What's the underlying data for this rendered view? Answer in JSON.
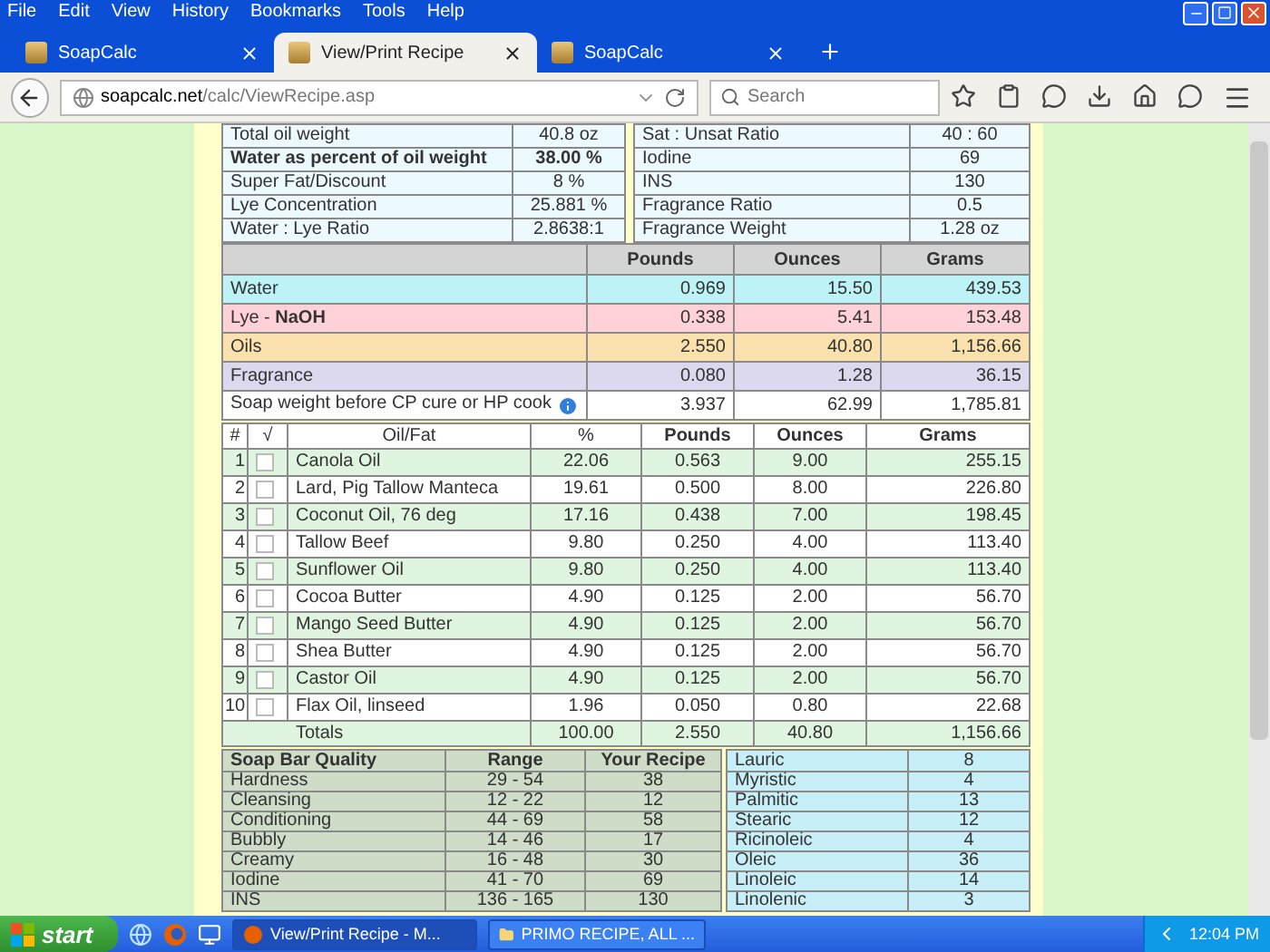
{
  "browser": {
    "menu": [
      "File",
      "Edit",
      "View",
      "History",
      "Bookmarks",
      "Tools",
      "Help"
    ],
    "tabs": [
      {
        "title": "SoapCalc",
        "selected": false
      },
      {
        "title": "View/Print Recipe",
        "selected": true
      },
      {
        "title": "SoapCalc",
        "selected": false
      }
    ],
    "address": {
      "host": "soapcalc.net",
      "path": "/calc/ViewRecipe.asp"
    },
    "search": {
      "placeholder": "Search"
    }
  },
  "recipe": {
    "left": [
      {
        "label": "Total oil weight",
        "value": "40.8 oz",
        "bold": false
      },
      {
        "label": "Water as percent of oil weight",
        "value": "38.00 %",
        "bold": true
      },
      {
        "label": "Super Fat/Discount",
        "value": "8 %",
        "bold": false
      },
      {
        "label": "Lye Concentration",
        "value": "25.881 %",
        "bold": false
      },
      {
        "label": "Water : Lye Ratio",
        "value": "2.8638:1",
        "bold": false
      }
    ],
    "right": [
      {
        "label": "Sat : Unsat Ratio",
        "value": "40 : 60"
      },
      {
        "label": "Iodine",
        "value": "69"
      },
      {
        "label": "INS",
        "value": "130"
      },
      {
        "label": "Fragrance Ratio",
        "value": "0.5"
      },
      {
        "label": "Fragrance Weight",
        "value": "1.28 oz"
      }
    ]
  },
  "summary": {
    "columns": [
      "Pounds",
      "Ounces",
      "Grams"
    ],
    "rows": [
      {
        "kind": "water",
        "label": "Water",
        "pounds": "0.969",
        "ounces": "15.50",
        "grams": "439.53"
      },
      {
        "kind": "lye",
        "label": "Lye - **NaOH**",
        "pounds": "0.338",
        "ounces": "5.41",
        "grams": "153.48"
      },
      {
        "kind": "oils",
        "label": "Oils",
        "pounds": "2.550",
        "ounces": "40.80",
        "grams": "1,156.66"
      },
      {
        "kind": "fragrance",
        "label": "Fragrance",
        "pounds": "0.080",
        "ounces": "1.28",
        "grams": "36.15"
      },
      {
        "kind": "total",
        "label": "Soap weight before CP cure or HP cook",
        "pounds": "3.937",
        "ounces": "62.99",
        "grams": "1,785.81"
      }
    ]
  },
  "oils": {
    "columns": [
      "#",
      "√",
      "Oil/Fat",
      "%",
      "Pounds",
      "Ounces",
      "Grams"
    ],
    "rows": [
      {
        "number": "1",
        "checked": false,
        "name": "Canola Oil",
        "percent": "22.06",
        "pounds": "0.563",
        "ounces": "9.00",
        "grams": "255.15"
      },
      {
        "number": "2",
        "checked": false,
        "name": "Lard, Pig Tallow Manteca",
        "percent": "19.61",
        "pounds": "0.500",
        "ounces": "8.00",
        "grams": "226.80"
      },
      {
        "number": "3",
        "checked": false,
        "name": "Coconut Oil, 76 deg",
        "percent": "17.16",
        "pounds": "0.438",
        "ounces": "7.00",
        "grams": "198.45"
      },
      {
        "number": "4",
        "checked": false,
        "name": "Tallow Beef",
        "percent": "9.80",
        "pounds": "0.250",
        "ounces": "4.00",
        "grams": "113.40"
      },
      {
        "number": "5",
        "checked": false,
        "name": "Sunflower Oil",
        "percent": "9.80",
        "pounds": "0.250",
        "ounces": "4.00",
        "grams": "113.40"
      },
      {
        "number": "6",
        "checked": false,
        "name": "Cocoa Butter",
        "percent": "4.90",
        "pounds": "0.125",
        "ounces": "2.00",
        "grams": "56.70"
      },
      {
        "number": "7",
        "checked": false,
        "name": "Mango Seed Butter",
        "percent": "4.90",
        "pounds": "0.125",
        "ounces": "2.00",
        "grams": "56.70"
      },
      {
        "number": "8",
        "checked": false,
        "name": "Shea Butter",
        "percent": "4.90",
        "pounds": "0.125",
        "ounces": "2.00",
        "grams": "56.70"
      },
      {
        "number": "9",
        "checked": false,
        "name": "Castor Oil",
        "percent": "4.90",
        "pounds": "0.125",
        "ounces": "2.00",
        "grams": "56.70"
      },
      {
        "number": "10",
        "checked": false,
        "name": "Flax Oil, linseed",
        "percent": "1.96",
        "pounds": "0.050",
        "ounces": "0.80",
        "grams": "22.68"
      }
    ],
    "totals": {
      "label": "Totals",
      "percent": "100.00",
      "pounds": "2.550",
      "ounces": "40.80",
      "grams": "1,156.66"
    }
  },
  "quality": {
    "columns": [
      "Soap Bar Quality",
      "Range",
      "Your Recipe"
    ],
    "rows": [
      {
        "name": "Hardness",
        "range": "29 - 54",
        "recipe": "38"
      },
      {
        "name": "Cleansing",
        "range": "12 - 22",
        "recipe": "12"
      },
      {
        "name": "Conditioning",
        "range": "44 - 69",
        "recipe": "58"
      },
      {
        "name": "Bubbly",
        "range": "14 - 46",
        "recipe": "17"
      },
      {
        "name": "Creamy",
        "range": "16 - 48",
        "recipe": "30"
      },
      {
        "name": "Iodine",
        "range": "41 - 70",
        "recipe": "69"
      },
      {
        "name": "INS",
        "range": "136 - 165",
        "recipe": "130"
      }
    ]
  },
  "fatty_acids": [
    {
      "name": "Lauric",
      "value": "8"
    },
    {
      "name": "Myristic",
      "value": "4"
    },
    {
      "name": "Palmitic",
      "value": "13"
    },
    {
      "name": "Stearic",
      "value": "12"
    },
    {
      "name": "Ricinoleic",
      "value": "4"
    },
    {
      "name": "Oleic",
      "value": "36"
    },
    {
      "name": "Linoleic",
      "value": "14"
    },
    {
      "name": "Linolenic",
      "value": "3"
    }
  ],
  "taskbar": {
    "start": "start",
    "tasks": [
      {
        "label": "View/Print Recipe - M...",
        "selected": true
      },
      {
        "label": "PRIMO RECIPE, ALL ...",
        "selected": false
      }
    ],
    "clock": "12:04 PM"
  }
}
